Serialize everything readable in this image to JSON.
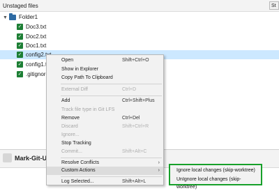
{
  "header": {
    "title": "Unstaged files",
    "stage_label": "St"
  },
  "tree": {
    "folder": "Folder1",
    "files": [
      {
        "name": "Doc3.txt"
      },
      {
        "name": "Doc2.txt"
      },
      {
        "name": "Doc1.txt"
      },
      {
        "name": "config2.txt"
      },
      {
        "name": "config1.txt"
      },
      {
        "name": ".gitignore"
      }
    ]
  },
  "commit": {
    "author": "Mark-Git-U"
  },
  "context_menu": {
    "items": [
      {
        "label": "Open",
        "shortcut": "Shift+Ctrl+O"
      },
      {
        "label": "Show in Explorer",
        "shortcut": ""
      },
      {
        "label": "Copy Path To Clipboard",
        "shortcut": ""
      },
      {
        "label": "External Diff",
        "shortcut": "Ctrl+D"
      },
      {
        "label": "Add",
        "shortcut": "Ctrl+Shift+Plus"
      },
      {
        "label": "Track file type in Git LFS",
        "shortcut": ""
      },
      {
        "label": "Remove",
        "shortcut": "Ctrl+Del"
      },
      {
        "label": "Discard",
        "shortcut": "Shift+Ctrl+R"
      },
      {
        "label": "Ignore...",
        "shortcut": ""
      },
      {
        "label": "Stop Tracking",
        "shortcut": ""
      },
      {
        "label": "Commit...",
        "shortcut": "Shift+Alt+C"
      },
      {
        "label": "Resolve Conflicts",
        "shortcut": ""
      },
      {
        "label": "Custom Actions",
        "shortcut": ""
      },
      {
        "label": "Log Selected...",
        "shortcut": "Shift+Alt+L"
      }
    ]
  },
  "submenu": {
    "items": [
      {
        "label": "Ignore local changes (skip-worktree)"
      },
      {
        "label": "UnIgnore local changes (skip-worktree)"
      }
    ]
  },
  "colors": {
    "checkbox": "#1d7f35",
    "highlight_border": "#17a02a",
    "selection": "#cce8ff",
    "folder": "#2d6aa3"
  },
  "icons": {
    "checkbox": "checkbox-checked-icon",
    "folder": "folder-icon",
    "chevron": "chevron-down-icon",
    "submenu": "chevron-right-icon"
  }
}
